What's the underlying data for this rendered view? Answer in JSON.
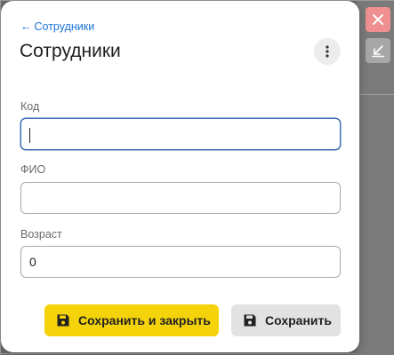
{
  "breadcrumb": {
    "arrow": "←",
    "label": "Сотрудники"
  },
  "title": "Сотрудники",
  "form": {
    "fields": [
      {
        "label": "Код",
        "value": "",
        "placeholder": ""
      },
      {
        "label": "ФИО",
        "value": "",
        "placeholder": ""
      },
      {
        "label": "Возраст",
        "value": "0",
        "placeholder": ""
      }
    ]
  },
  "buttons": {
    "save_close_label": "Сохранить и закрыть",
    "save_label": "Сохранить"
  },
  "icons": {
    "close": "close-icon",
    "minimize": "minimize-arrow-icon",
    "more": "more-vertical-icon",
    "save": "floppy-disk-icon",
    "back": "arrow-left-icon"
  },
  "colors": {
    "accent_link": "#1f74d6",
    "primary_button": "#f5d30a",
    "secondary_button": "#e2e2e2",
    "close_button": "#ef8f8f",
    "focus_border": "#3f6fb5"
  }
}
